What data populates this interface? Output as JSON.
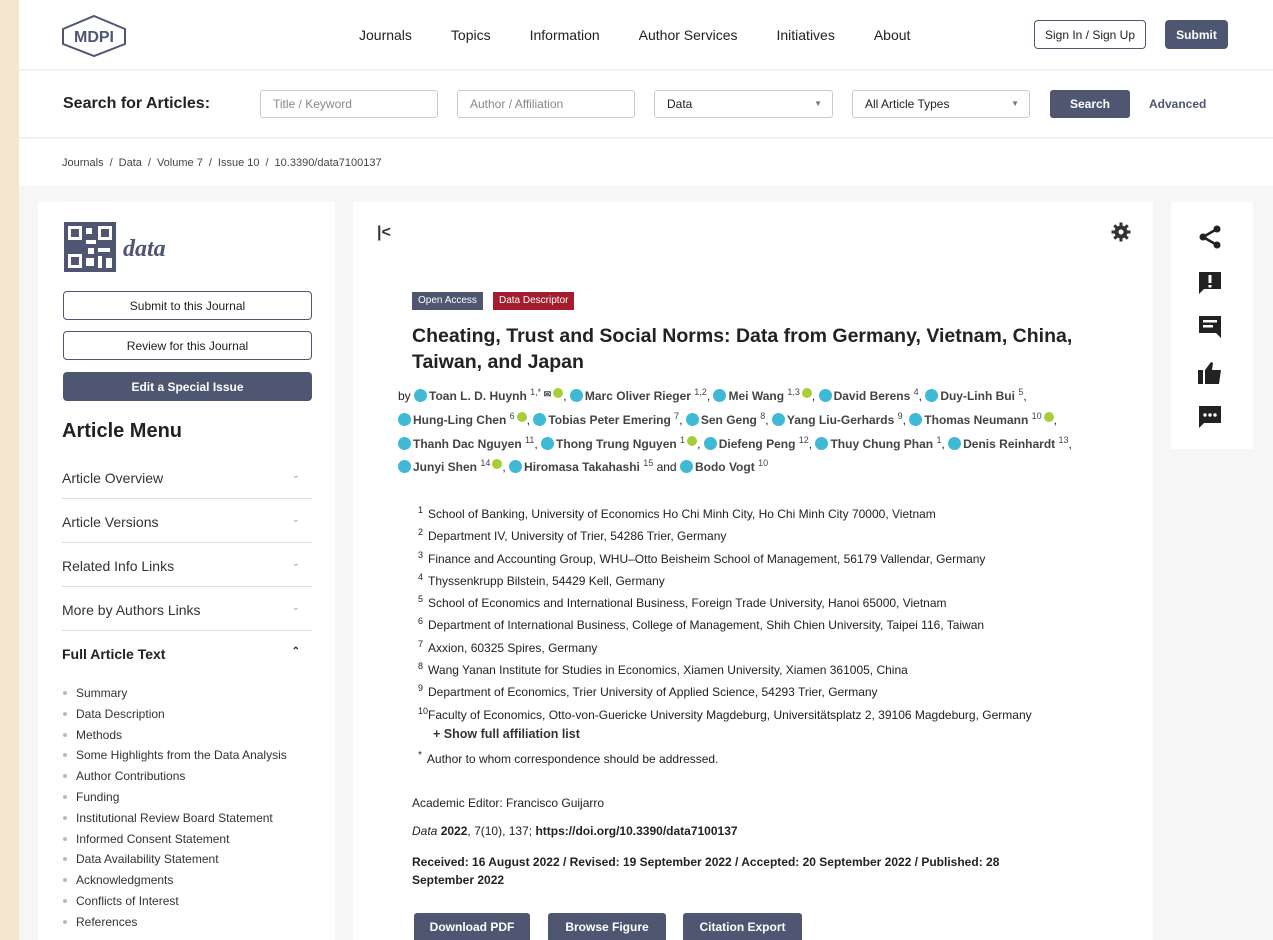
{
  "header": {
    "logo_text": "MDPI",
    "nav": [
      "Journals",
      "Topics",
      "Information",
      "Author Services",
      "Initiatives",
      "About"
    ],
    "signin_label": "Sign In / Sign Up",
    "submit_label": "Submit"
  },
  "search": {
    "label": "Search for Articles:",
    "title_placeholder": "Title / Keyword",
    "author_placeholder": "Author / Affiliation",
    "journal_value": "Data",
    "type_value": "All Article Types",
    "search_button": "Search",
    "advanced": "Advanced"
  },
  "breadcrumb": [
    "Journals",
    "Data",
    "Volume 7",
    "Issue 10",
    "10.3390/data7100137"
  ],
  "sidebar": {
    "journal_name": "data",
    "submit_btn": "Submit to this Journal",
    "review_btn": "Review for this Journal",
    "special_btn": "Edit a Special Issue",
    "menu_title": "Article Menu",
    "sections": [
      "Article Overview",
      "Article Versions",
      "Related Info Links",
      "More by Authors Links",
      "Full Article Text"
    ],
    "toc": [
      "Summary",
      "Data Description",
      "Methods",
      "Some Highlights from the Data Analysis",
      "Author Contributions",
      "Funding",
      "Institutional Review Board Statement",
      "Informed Consent Statement",
      "Data Availability Statement",
      "Acknowledgments",
      "Conflicts of Interest",
      "References"
    ]
  },
  "article": {
    "badge_open": "Open Access",
    "badge_type": "Data Descriptor",
    "title": "Cheating, Trust and Social Norms: Data from Germany, Vietnam, China, Taiwan, and Japan",
    "by": "by",
    "and": "and",
    "authors": [
      {
        "name": "Toan L. D. Huynh",
        "aff": "1,*",
        "mail": true,
        "orcid": true
      },
      {
        "name": "Marc Oliver Rieger",
        "aff": "1,2",
        "mail": false,
        "orcid": false
      },
      {
        "name": "Mei Wang",
        "aff": "1,3",
        "mail": false,
        "orcid": true
      },
      {
        "name": "David Berens",
        "aff": "4",
        "mail": false,
        "orcid": false
      },
      {
        "name": "Duy-Linh Bui",
        "aff": "5",
        "mail": false,
        "orcid": false
      },
      {
        "name": "Hung-Ling Chen",
        "aff": "6",
        "mail": false,
        "orcid": true
      },
      {
        "name": "Tobias Peter Emering",
        "aff": "7",
        "mail": false,
        "orcid": false
      },
      {
        "name": "Sen Geng",
        "aff": "8",
        "mail": false,
        "orcid": false
      },
      {
        "name": "Yang Liu-Gerhards",
        "aff": "9",
        "mail": false,
        "orcid": false
      },
      {
        "name": "Thomas Neumann",
        "aff": "10",
        "mail": false,
        "orcid": true
      },
      {
        "name": "Thanh Dac Nguyen",
        "aff": "11",
        "mail": false,
        "orcid": false
      },
      {
        "name": "Thong Trung Nguyen",
        "aff": "1",
        "mail": false,
        "orcid": true
      },
      {
        "name": "Diefeng Peng",
        "aff": "12",
        "mail": false,
        "orcid": false
      },
      {
        "name": "Thuy Chung Phan",
        "aff": "1",
        "mail": false,
        "orcid": false
      },
      {
        "name": "Denis Reinhardt",
        "aff": "13",
        "mail": false,
        "orcid": false
      },
      {
        "name": "Junyi Shen",
        "aff": "14",
        "mail": false,
        "orcid": true
      },
      {
        "name": "Hiromasa Takahashi",
        "aff": "15",
        "mail": false,
        "orcid": false
      },
      {
        "name": "Bodo Vogt",
        "aff": "10",
        "mail": false,
        "orcid": false
      }
    ],
    "affiliations": [
      {
        "n": "1",
        "text": "School of Banking, University of Economics Ho Chi Minh City, Ho Chi Minh City 70000, Vietnam"
      },
      {
        "n": "2",
        "text": "Department IV, University of Trier, 54286 Trier, Germany"
      },
      {
        "n": "3",
        "text": "Finance and Accounting Group, WHU–Otto Beisheim School of Management, 56179 Vallendar, Germany"
      },
      {
        "n": "4",
        "text": "Thyssenkrupp Bilstein, 54429 Kell, Germany"
      },
      {
        "n": "5",
        "text": "School of Economics and International Business, Foreign Trade University, Hanoi 65000, Vietnam"
      },
      {
        "n": "6",
        "text": "Department of International Business, College of Management, Shih Chien University, Taipei 116, Taiwan"
      },
      {
        "n": "7",
        "text": "Axxion, 60325 Spires, Germany"
      },
      {
        "n": "8",
        "text": "Wang Yanan Institute for Studies in Economics, Xiamen University, Xiamen 361005, China"
      },
      {
        "n": "9",
        "text": "Department of Economics, Trier University of Applied Science, 54293 Trier, Germany"
      },
      {
        "n": "10",
        "text": "Faculty of Economics, Otto-von-Guericke University Magdeburg, Universitätsplatz 2, 39106 Magdeburg, Germany"
      }
    ],
    "show_more": "+ Show full affiliation list",
    "corr_mark": "*",
    "corr_text": "Author to whom correspondence should be addressed.",
    "editor": "Academic Editor: Francisco Guijarro",
    "cite_journal": "Data",
    "cite_year": "2022",
    "cite_rest": ", 7(10), 137; ",
    "cite_doi": "https://doi.org/10.3390/data7100137",
    "dates": "Received: 16 August 2022 / Revised: 19 September 2022 / Accepted: 20 September 2022 / Published: 28 September 2022",
    "btn_pdf": "Download PDF",
    "btn_figure": "Browse Figure",
    "btn_citation": "Citation Export"
  },
  "colors": {
    "primary": "#4f5671",
    "badge_red": "#a51d2d",
    "author_icon": "#3fb9d6",
    "orcid": "#a6ce39"
  }
}
